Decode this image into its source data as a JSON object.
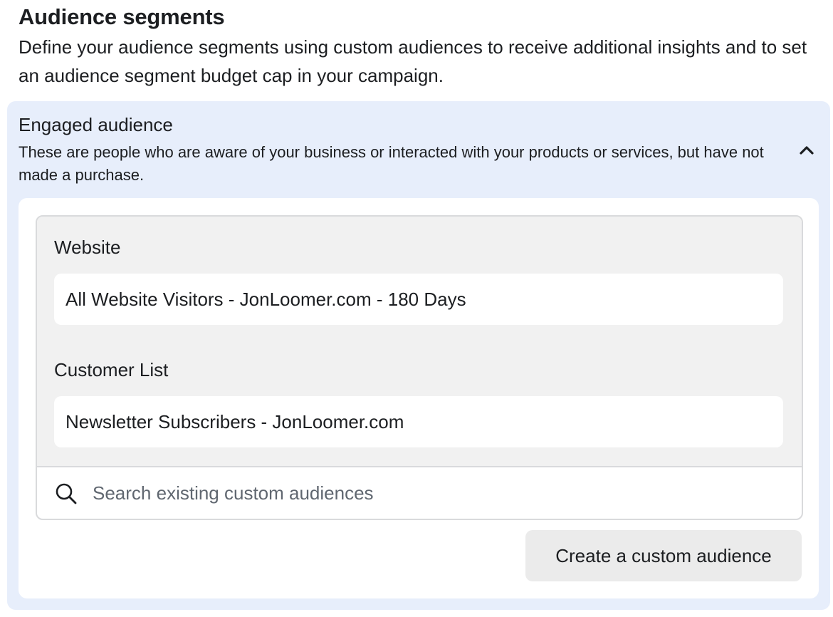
{
  "section": {
    "title": "Audience segments",
    "description": "Define your audience segments using custom audiences to receive additional insights and to set an audience segment budget cap in your campaign."
  },
  "segment": {
    "title": "Engaged audience",
    "description": "These are people who are aware of your business or interacted with your products or services, but have not made a purchase.",
    "collapse_icon": "chevron-up-icon",
    "groups": [
      {
        "label": "Website",
        "audiences": [
          "All Website Visitors - JonLoomer.com - 180 Days"
        ]
      },
      {
        "label": "Customer List",
        "audiences": [
          "Newsletter Subscribers - JonLoomer.com"
        ]
      }
    ],
    "search": {
      "icon": "search-icon",
      "placeholder": "Search existing custom audiences",
      "value": ""
    },
    "create_button_label": "Create a custom audience"
  }
}
